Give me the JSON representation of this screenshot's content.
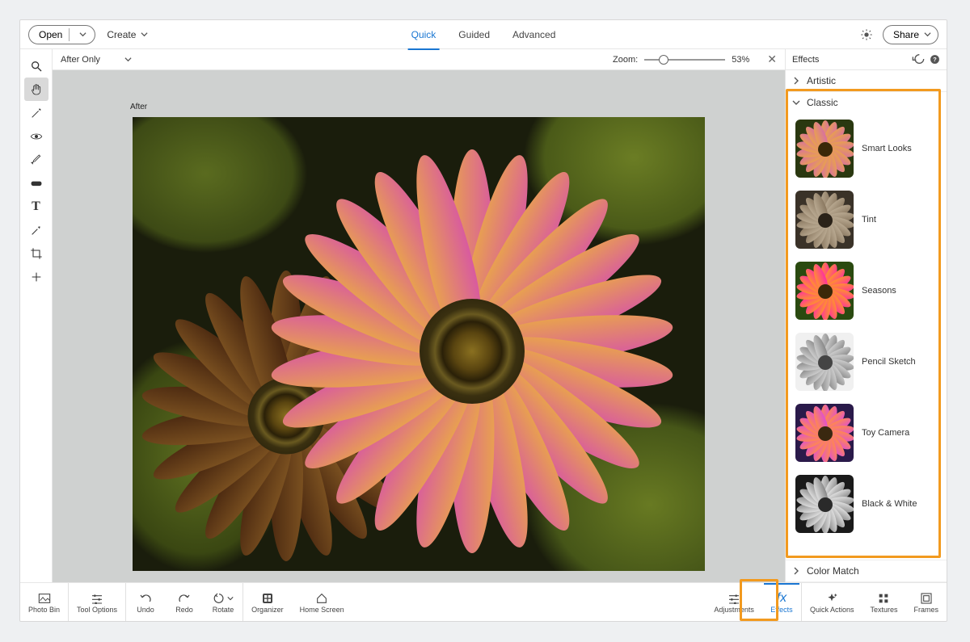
{
  "topbar": {
    "open": "Open",
    "create": "Create",
    "share": "Share",
    "tabs": {
      "quick": "Quick",
      "guided": "Guided",
      "advanced": "Advanced"
    }
  },
  "subbar": {
    "view": "After Only",
    "zoom_label": "Zoom:",
    "zoom_value": "53%",
    "after_label": "After"
  },
  "tools": {
    "zoom": "zoom-icon",
    "hand": "hand-icon",
    "selection": "selection-icon",
    "eye": "eye-icon",
    "brush": "brush-icon",
    "spot": "spot-icon",
    "text": "text-icon",
    "whiten": "whiten-icon",
    "crop": "crop-icon",
    "move": "move-icon"
  },
  "panel": {
    "title": "Effects",
    "categories": {
      "artistic": "Artistic",
      "classic": "Classic",
      "color_match": "Color Match"
    },
    "classic_items": [
      {
        "label": "Smart Looks",
        "type": "color"
      },
      {
        "label": "Tint",
        "type": "sepia"
      },
      {
        "label": "Seasons",
        "type": "saturated"
      },
      {
        "label": "Pencil Sketch",
        "type": "sketch"
      },
      {
        "label": "Toy Camera",
        "type": "toy"
      },
      {
        "label": "Black & White",
        "type": "bw"
      }
    ]
  },
  "bottom": {
    "photo_bin": "Photo Bin",
    "tool_options": "Tool Options",
    "undo": "Undo",
    "redo": "Redo",
    "rotate": "Rotate",
    "organizer": "Organizer",
    "home": "Home Screen",
    "adjustments": "Adjustments",
    "effects": "Effects",
    "quick_actions": "Quick Actions",
    "textures": "Textures",
    "frames": "Frames"
  }
}
